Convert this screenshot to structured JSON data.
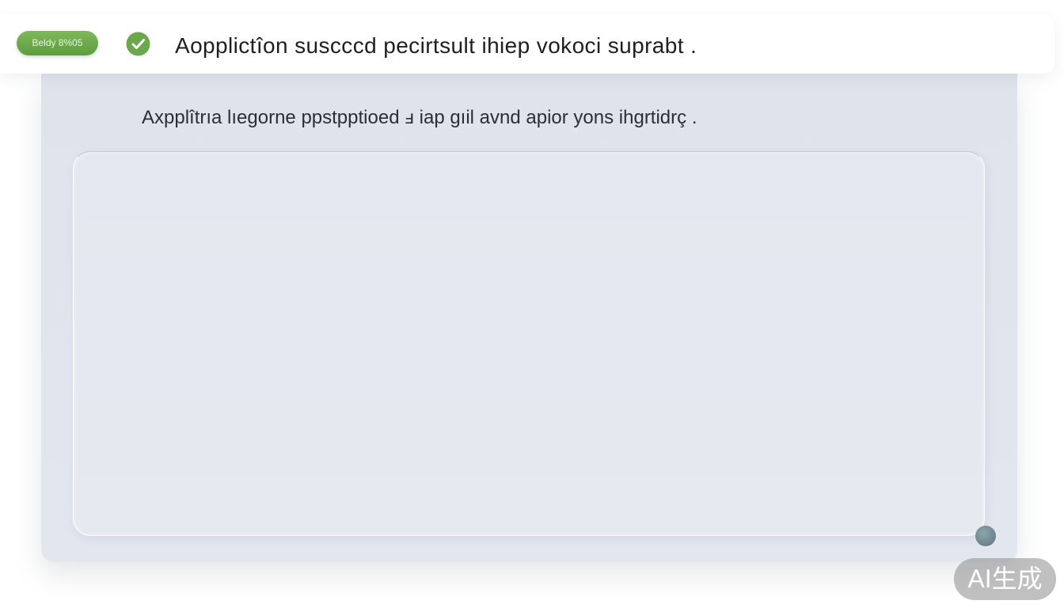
{
  "banner": {
    "badge_label": "Beldy 8%05",
    "check_icon": "checkmark-circle-icon",
    "title": "Aopplictîon suscccd pecirtsult ihiep vokoci suprabt  ."
  },
  "card": {
    "subtitle": "Axpplîtrıa lıegorne ppstpptioed ⅎ iap gıil avnd apior yons ihgrtidrç .",
    "content_area": {
      "value": ""
    },
    "resize_handle_icon": "resize-handle-icon"
  },
  "watermark": {
    "text": "AI生成"
  },
  "colors": {
    "success": "#6aa84a",
    "card_background": "#dfe3ec"
  }
}
